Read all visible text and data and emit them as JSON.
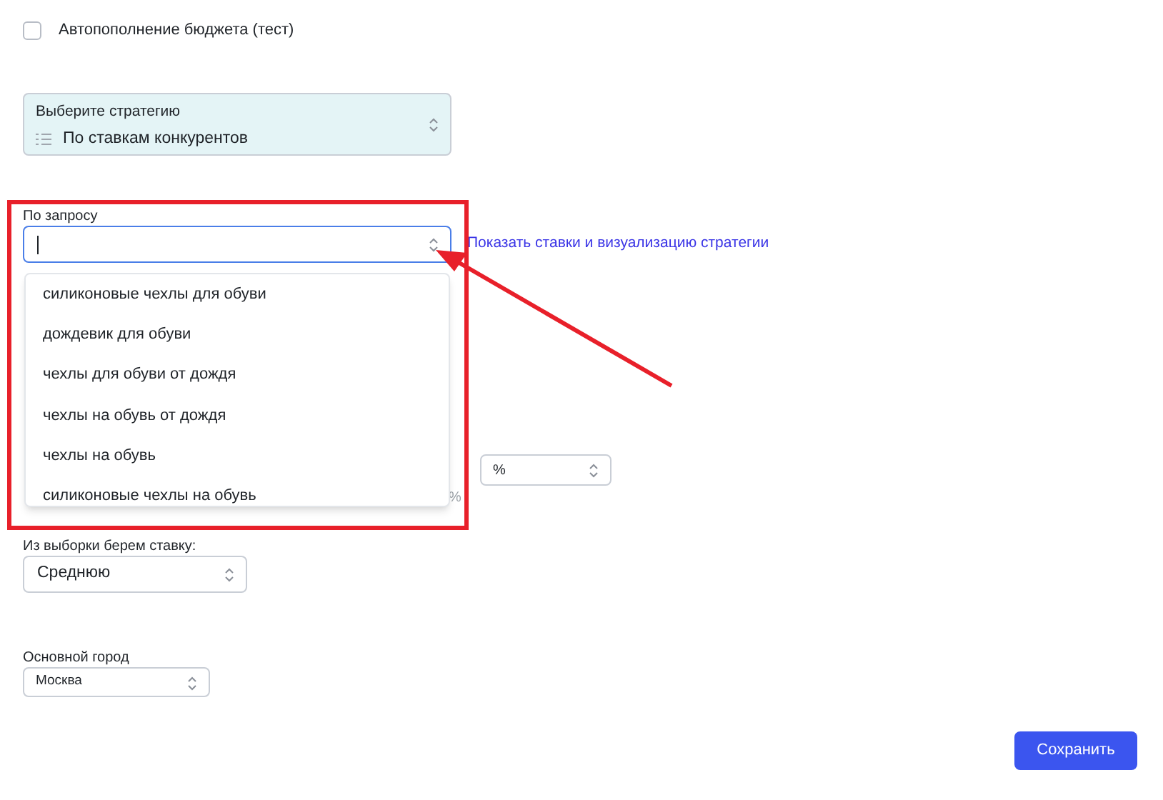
{
  "autofill": {
    "label": "Автопополнение бюджета (тест)",
    "checked": false
  },
  "strategy": {
    "label": "Выберите стратегию",
    "value": "По ставкам конкурентов"
  },
  "query": {
    "label": "По запросу",
    "focused": true,
    "link": "Показать ставки и визуализацию стратегии",
    "options": [
      {
        "label": "силиконовые чехлы для обуви"
      },
      {
        "label": "дождевик для обуви"
      },
      {
        "label": "чехлы для обуви от дождя"
      },
      {
        "label": "чехлы на обувь от дождя"
      },
      {
        "label": "чехлы на обувь"
      },
      {
        "label": "силиконовые чехлы на обувь"
      }
    ]
  },
  "hidden_row": {
    "suffix": "%",
    "unit_select": "%"
  },
  "bid_pick": {
    "label": "Из выборки берем ставку:",
    "value": "Среднюю"
  },
  "city": {
    "label": "Основной город",
    "value": "Москва"
  },
  "save_button": "Сохранить"
}
